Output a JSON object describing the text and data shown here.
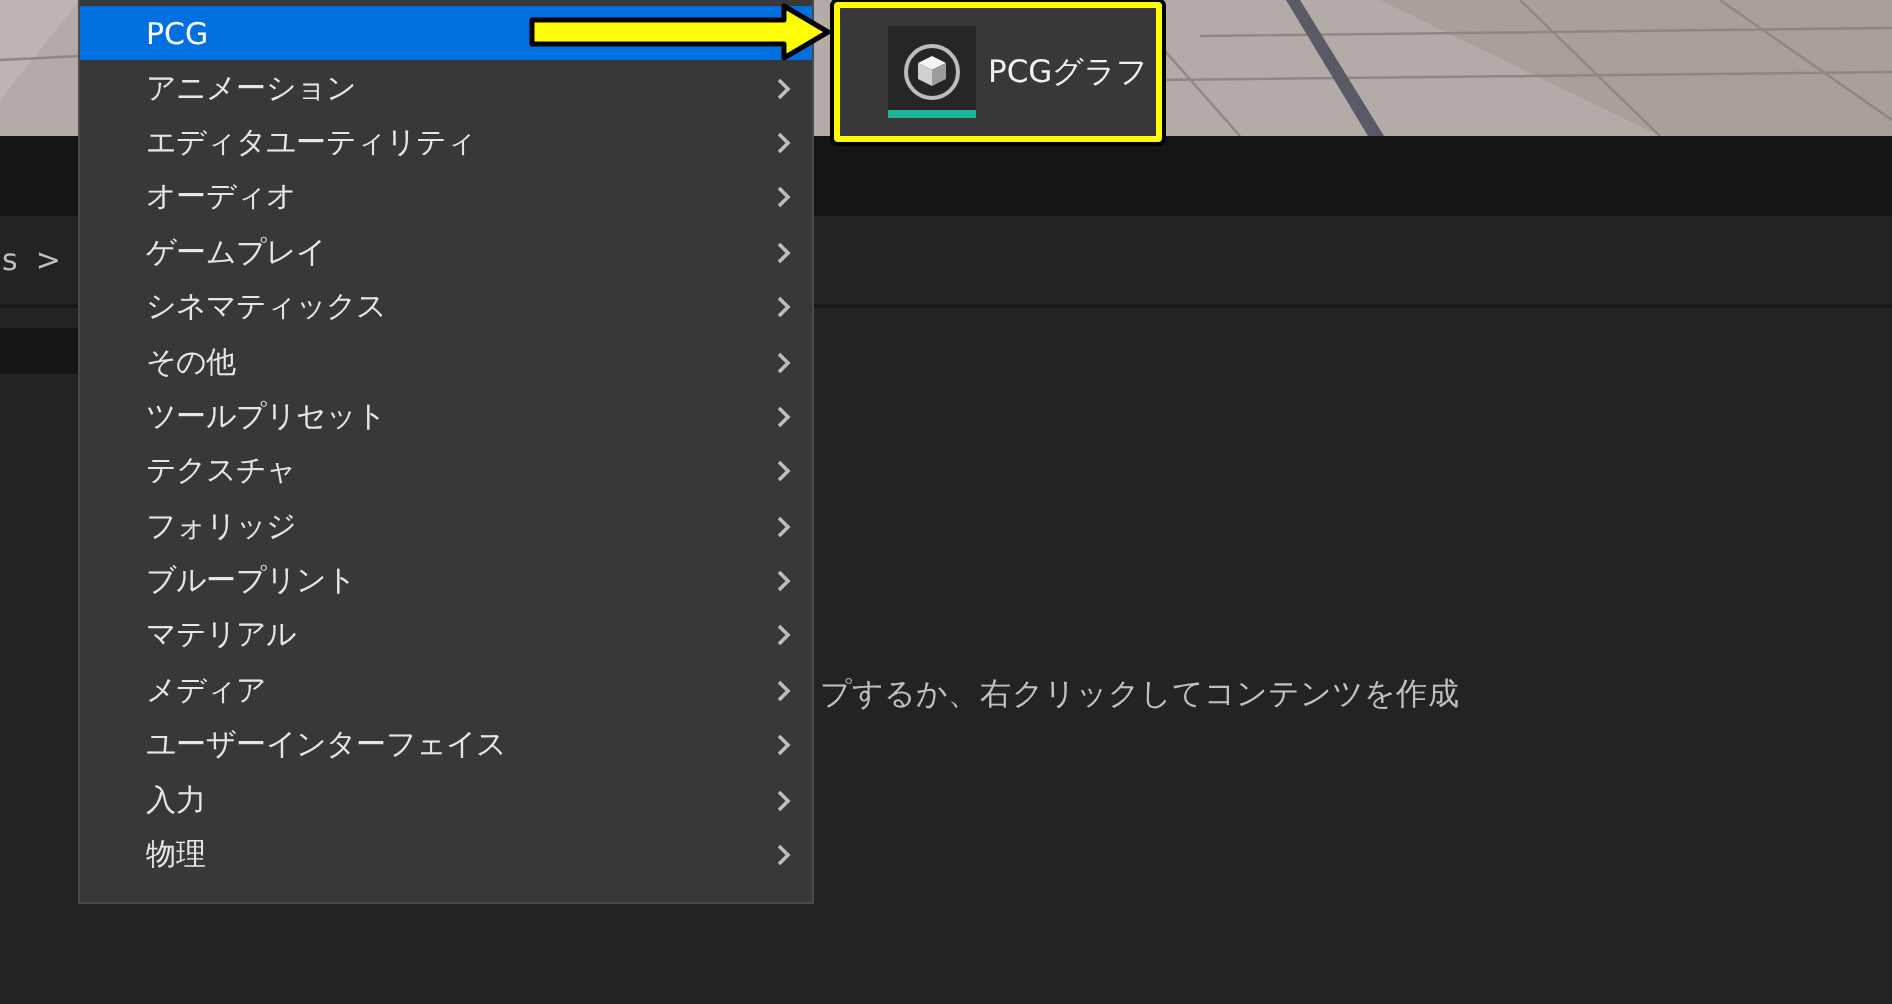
{
  "breadcrumb": {
    "text": "s",
    "separator": ">"
  },
  "empty_message": "プするか、右クリックしてコンテンツを作成",
  "menu": {
    "items": [
      {
        "label": "PCG",
        "selected": true,
        "has_arrow": false
      },
      {
        "label": "アニメーション",
        "selected": false,
        "has_arrow": true
      },
      {
        "label": "エディタユーティリティ",
        "selected": false,
        "has_arrow": true
      },
      {
        "label": "オーディオ",
        "selected": false,
        "has_arrow": true
      },
      {
        "label": "ゲームプレイ",
        "selected": false,
        "has_arrow": true
      },
      {
        "label": "シネマティックス",
        "selected": false,
        "has_arrow": true
      },
      {
        "label": "その他",
        "selected": false,
        "has_arrow": true
      },
      {
        "label": "ツールプリセット",
        "selected": false,
        "has_arrow": true
      },
      {
        "label": "テクスチャ",
        "selected": false,
        "has_arrow": true
      },
      {
        "label": "フォリッジ",
        "selected": false,
        "has_arrow": true
      },
      {
        "label": "ブループリント",
        "selected": false,
        "has_arrow": true
      },
      {
        "label": "マテリアル",
        "selected": false,
        "has_arrow": true
      },
      {
        "label": "メディア",
        "selected": false,
        "has_arrow": true
      },
      {
        "label": "ユーザーインターフェイス",
        "selected": false,
        "has_arrow": true
      },
      {
        "label": "入力",
        "selected": false,
        "has_arrow": true
      },
      {
        "label": "物理",
        "selected": false,
        "has_arrow": true
      }
    ]
  },
  "submenu": {
    "items": [
      {
        "label": "PCGグラフ"
      }
    ]
  }
}
